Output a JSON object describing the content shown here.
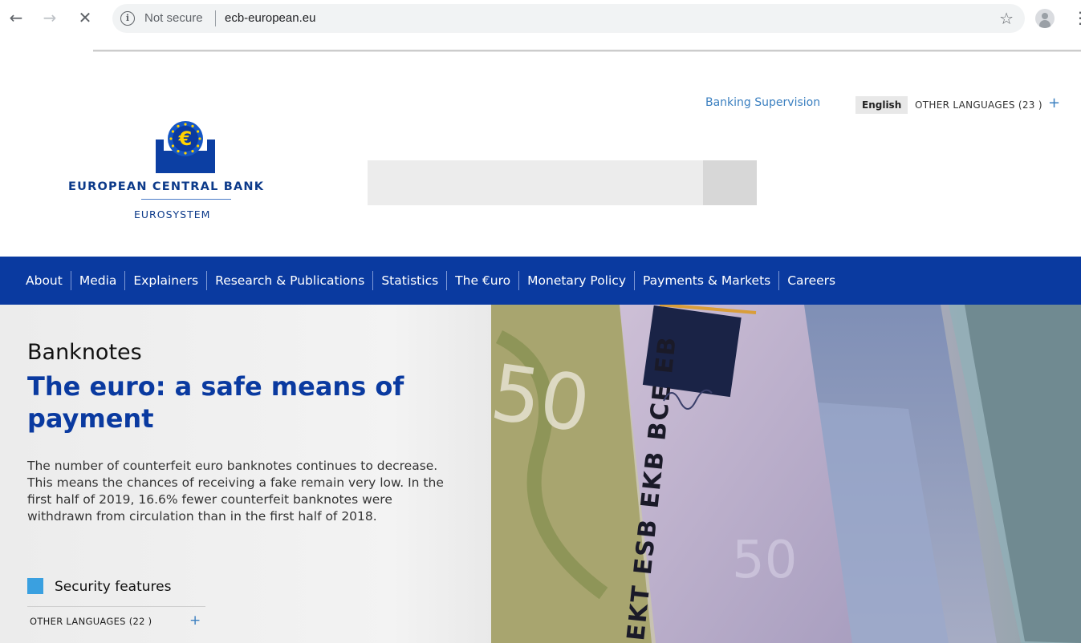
{
  "browser": {
    "security_label": "Not secure",
    "url": "ecb-european.eu",
    "icons": [
      "back-icon",
      "forward-icon",
      "close-icon",
      "info-icon",
      "star-icon",
      "profile-icon",
      "menu-icon"
    ]
  },
  "utility": {
    "banking_supervision": "Banking Supervision",
    "lang_current": "English",
    "lang_other": "OTHER LANGUAGES (23 )",
    "plus": "+"
  },
  "logo": {
    "title": "EUROPEAN CENTRAL BANK",
    "subtitle": "EUROSYSTEM",
    "symbol": "€"
  },
  "nav": {
    "items": [
      "About",
      "Media",
      "Explainers",
      "Research & Publications",
      "Statistics",
      "The €uro",
      "Monetary Policy",
      "Payments & Markets",
      "Careers"
    ]
  },
  "article": {
    "category": "Banknotes",
    "headline": "The euro: a safe means of payment",
    "lead": "The number of counterfeit euro banknotes continues to decrease. This means the chances of receiving a fake remain very low. In the first half of 2019, 16.6% fewer counterfeit banknotes were withdrawn from circulation than in the first half of 2018.",
    "link_label": "Security features",
    "other_languages": "OTHER LANGUAGES  (22 )",
    "plus": "+"
  },
  "hero": {
    "strip_text": "EKT ESB EKB BCE EB",
    "note_value": "50"
  },
  "colors": {
    "nav_bg": "#0a3aa0",
    "brand_text": "#0c3a8a",
    "link": "#3a7fc0",
    "accent_square": "#3aa0e0"
  }
}
